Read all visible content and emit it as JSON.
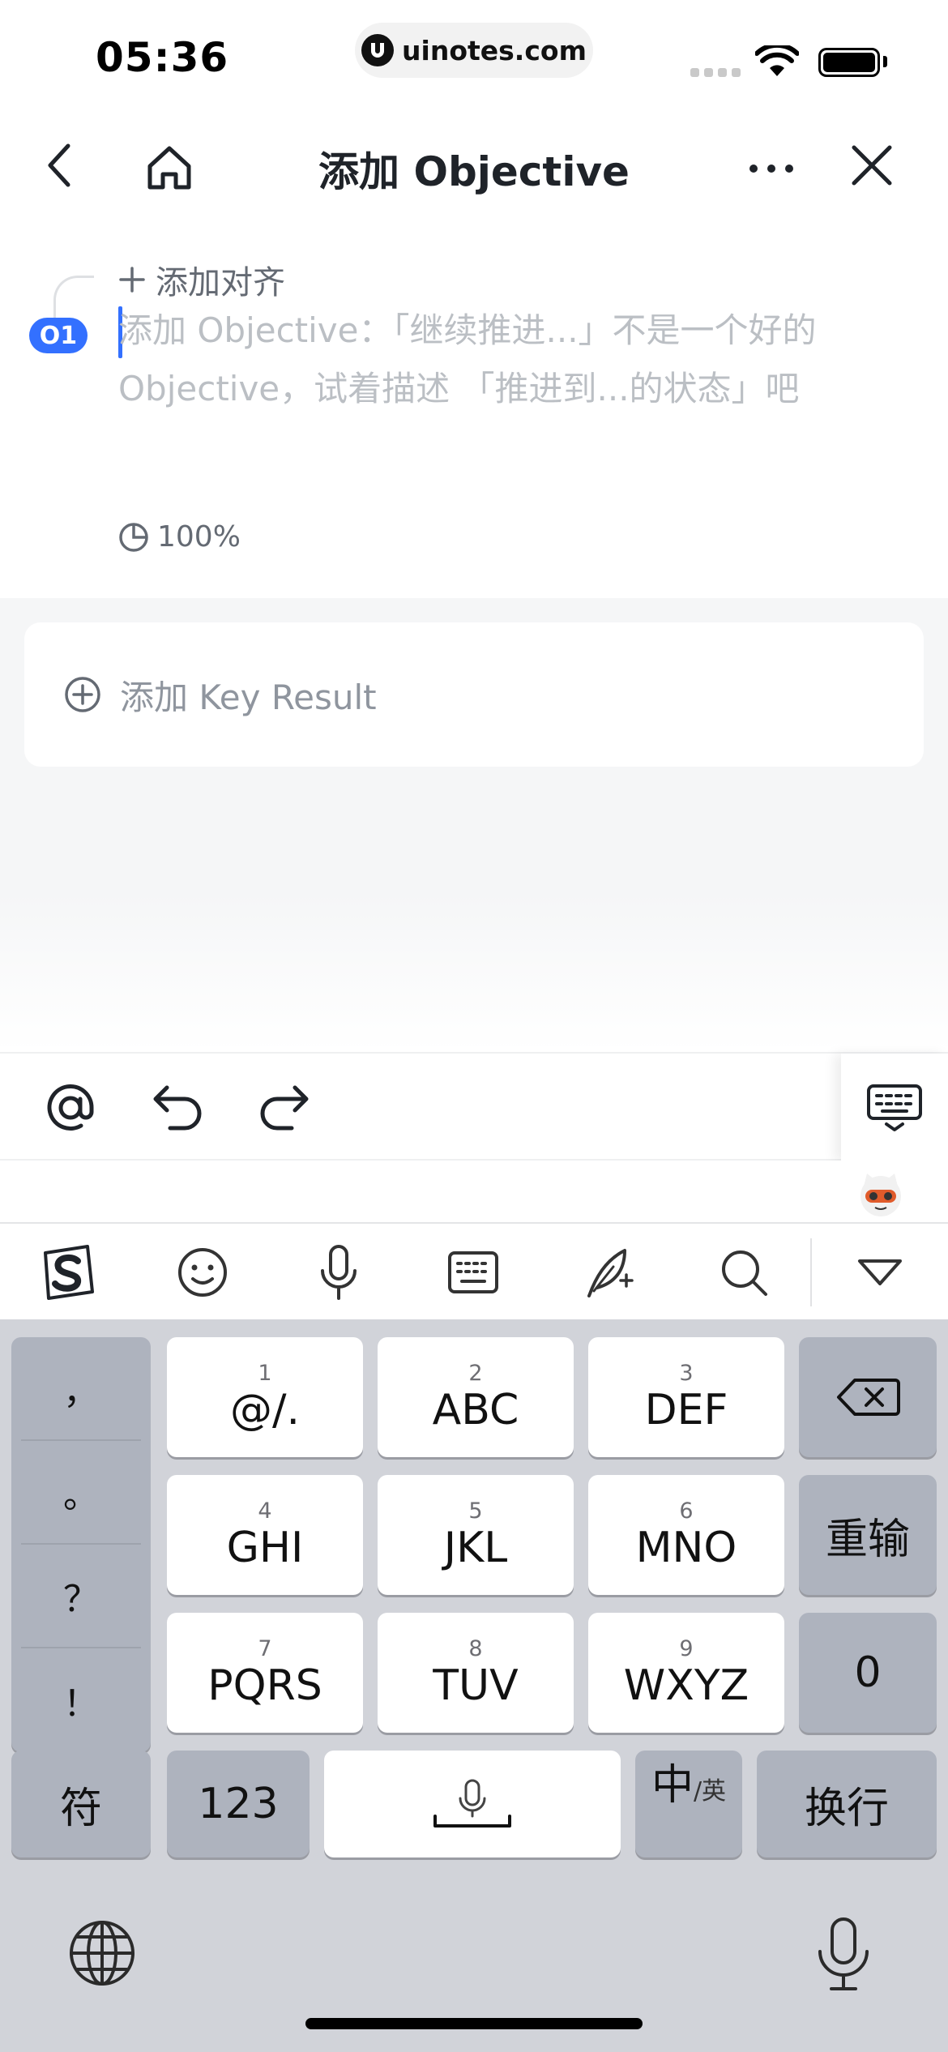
{
  "status_bar": {
    "time": "05:36",
    "url": "uinotes.com"
  },
  "nav": {
    "title": "添加 Objective"
  },
  "objective": {
    "align_label": "添加对齐",
    "badge": "O1",
    "placeholder": "添加 Objective：「继续推进...」不是一个好的 Objective，试着描述 「推进到...的状态」吧",
    "progress": "100%"
  },
  "key_result": {
    "add_label": "添加 Key Result"
  },
  "keyboard": {
    "punctuation": [
      "，",
      "。",
      "？",
      "！"
    ],
    "keys": [
      {
        "num": "1",
        "label": "@/."
      },
      {
        "num": "2",
        "label": "ABC"
      },
      {
        "num": "3",
        "label": "DEF"
      },
      {
        "num": "4",
        "label": "GHI"
      },
      {
        "num": "5",
        "label": "JKL"
      },
      {
        "num": "6",
        "label": "MNO"
      },
      {
        "num": "7",
        "label": "PQRS"
      },
      {
        "num": "8",
        "label": "TUV"
      },
      {
        "num": "9",
        "label": "WXYZ"
      }
    ],
    "retype": "重输",
    "zero": "0",
    "symbols": "符",
    "numbers": "123",
    "lang_main": "中",
    "lang_sub": "/英",
    "newline": "换行"
  },
  "colors": {
    "accent": "#3370ff",
    "placeholder": "#bbbfc4",
    "keyboard_bg": "#d1d3d9"
  },
  "icons": [
    "back-icon",
    "home-icon",
    "more-icon",
    "close-icon",
    "plus-icon",
    "pie-chart-icon",
    "add-circle-icon",
    "at-icon",
    "undo-icon",
    "redo-icon",
    "keyboard-hide-icon",
    "sogou-icon",
    "emoji-icon",
    "voice-icon",
    "keyboard-icon",
    "handwriting-icon",
    "search-icon",
    "collapse-icon",
    "backspace-icon",
    "globe-icon",
    "mic-icon"
  ]
}
